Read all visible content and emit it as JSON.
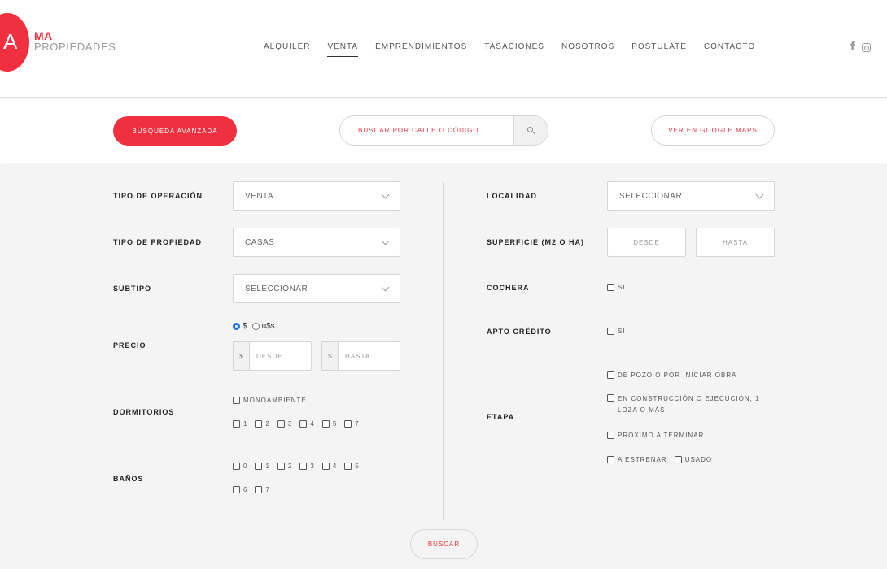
{
  "brand": {
    "letter": "A",
    "line1": "MA",
    "line2": "PROPIEDADES",
    "color": "#f0303f"
  },
  "nav": {
    "items": [
      {
        "label": "ALQUILER",
        "active": false
      },
      {
        "label": "VENTA",
        "active": true
      },
      {
        "label": "EMPRENDIMIENTOS",
        "active": false
      },
      {
        "label": "TASACIONES",
        "active": false
      },
      {
        "label": "NOSOTROS",
        "active": false
      },
      {
        "label": "POSTULATE",
        "active": false
      },
      {
        "label": "CONTACTO",
        "active": false
      }
    ],
    "social": {
      "facebook_glyph": "f",
      "facebook_icon": "facebook-icon",
      "instagram_icon": "instagram-icon"
    }
  },
  "searchbar": {
    "advanced_label": "BÚSQUEDA AVANZADA",
    "search_placeholder": "BUSCAR POR CALLE O CÓDIGO",
    "search_icon": "search-icon",
    "maps_label": "VER EN GOOGLE MAPS"
  },
  "form": {
    "operation": {
      "label": "TIPO DE OPERACIÓN",
      "value": "VENTA"
    },
    "property_type": {
      "label": "TIPO DE PROPIEDAD",
      "value": "CASAS"
    },
    "subtype": {
      "label": "SUBTIPO",
      "value": "SELECCIONAR"
    },
    "price": {
      "label": "PRECIO",
      "currencies": [
        {
          "label": "$",
          "checked": true
        },
        {
          "label": "u$s",
          "checked": false
        }
      ],
      "from_addon": "$",
      "from_placeholder": "DESDE",
      "to_addon": "$",
      "to_placeholder": "HASTA"
    },
    "bedrooms": {
      "label": "DORMITORIOS",
      "studio": "MONOAMBIENTE",
      "options": [
        "1",
        "2",
        "3",
        "4",
        "5",
        "7"
      ]
    },
    "bathrooms": {
      "label": "BAÑOS",
      "row1": [
        "0",
        "1",
        "2",
        "3",
        "4",
        "5"
      ],
      "row2": [
        "6",
        "7"
      ]
    },
    "locality": {
      "label": "LOCALIDAD",
      "value": "SELECCIONAR"
    },
    "surface": {
      "label": "SUPERFICIE (M2 O HA)",
      "from_placeholder": "DESDE",
      "to_placeholder": "HASTA"
    },
    "garage": {
      "label": "COCHERA",
      "option": "SI"
    },
    "credit": {
      "label": "APTO CRÉDITO",
      "option": "SI"
    },
    "stage": {
      "label": "ETAPA",
      "options": [
        "DE POZO O POR INICIAR OBRA",
        "EN CONSTRUCCIÓN O EJECUCIÓN, 1 LOZA O MÁS",
        "PRÓXIMO A TERMINAR",
        "A ESTRENAR",
        "USADO"
      ]
    },
    "submit_label": "BUSCAR"
  }
}
